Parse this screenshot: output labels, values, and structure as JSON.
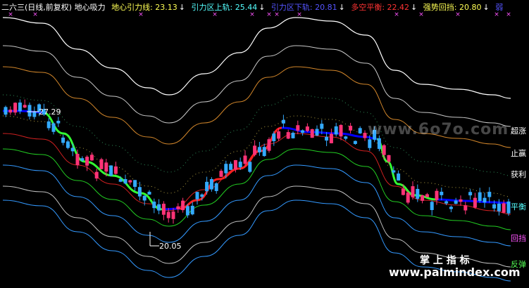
{
  "header": {
    "title": "二六三(日线,前复权) 地心吸力",
    "items": [
      {
        "label": "地心引力线",
        "value": "23.13",
        "color": "#ffff55"
      },
      {
        "label": "引力区上轨",
        "value": "25.44",
        "color": "#55ffff"
      },
      {
        "label": "引力区下轨",
        "value": "20.81",
        "color": "#5555ff"
      },
      {
        "label": "多空平衡",
        "value": "22.42",
        "color": "#ff3333"
      },
      {
        "label": "强势回挡",
        "value": "20.80",
        "color": "#ffff55"
      },
      {
        "label": "弱",
        "value": "",
        "color": "#5555ff"
      }
    ],
    "arrow": "↓"
  },
  "right_labels": [
    {
      "text": "超涨",
      "color": "#ffffff"
    },
    {
      "text": "止赢",
      "color": "#ffffff"
    },
    {
      "text": "获利",
      "color": "#ffffff"
    },
    {
      "text": "平衡",
      "color": "#55ffff"
    },
    {
      "text": "回挡",
      "color": "#ff55ff"
    },
    {
      "text": "反弹",
      "color": "#55ff55"
    }
  ],
  "annotations": {
    "high": "27.29",
    "low": "20.05",
    "signal_mark": "×"
  },
  "watermark": {
    "top": "www.6o7o.com",
    "bottom_cn": "掌 上 指 标",
    "bottom_url": "www.palmindex.com"
  },
  "chart_data": {
    "type": "line",
    "series": [
      {
        "name": "地心引力线",
        "color": "#ffff55",
        "values": [
          24.6,
          24.5,
          24.3,
          24.1,
          23.8,
          23.5,
          23.2,
          23.0,
          22.7,
          22.5,
          22.3,
          22.2,
          22.3,
          22.6,
          23.0,
          23.5,
          23.9,
          24.2,
          24.3,
          24.3,
          24.2,
          23.9,
          23.6,
          23.4,
          23.2,
          23.1
        ]
      },
      {
        "name": "引力区上轨",
        "color": "#55ffff",
        "values": [
          27.0,
          26.9,
          26.7,
          26.4,
          26.1,
          25.8,
          25.5,
          25.2,
          24.9,
          24.7,
          24.5,
          24.4,
          24.5,
          24.8,
          25.2,
          25.7,
          26.1,
          26.4,
          26.5,
          26.5,
          26.4,
          26.1,
          25.8,
          25.6,
          25.4,
          25.4
        ]
      },
      {
        "name": "引力区下轨",
        "color": "#5555ff",
        "values": [
          22.2,
          22.1,
          21.9,
          21.7,
          21.4,
          21.1,
          20.8,
          20.6,
          20.4,
          20.2,
          20.1,
          20.0,
          20.1,
          20.4,
          20.8,
          21.3,
          21.7,
          22.0,
          22.1,
          22.1,
          22.0,
          21.7,
          21.4,
          21.1,
          20.9,
          20.8
        ]
      },
      {
        "name": "多空平衡",
        "color": "#ff3333",
        "values": [
          25.3,
          25.3,
          25.2,
          25.1,
          24.8,
          24.4,
          24.0,
          23.6,
          23.1,
          22.6,
          22.2,
          22.2,
          22.6,
          23.1,
          23.6,
          24.1,
          24.6,
          24.9,
          24.9,
          24.7,
          24.3,
          23.8,
          23.3,
          22.8,
          22.5,
          22.4
        ]
      },
      {
        "name": "强势回挡",
        "color": "#ffff55",
        "values": [
          24.5,
          24.4,
          24.2,
          23.9,
          23.5,
          23.1,
          22.6,
          22.1,
          21.6,
          21.1,
          20.7,
          20.6,
          20.9,
          21.5,
          22.1,
          22.7,
          23.2,
          23.5,
          23.6,
          23.4,
          22.9,
          22.3,
          21.7,
          21.2,
          20.9,
          20.8
        ]
      }
    ],
    "high_point": 27.29,
    "low_point": 20.05
  }
}
